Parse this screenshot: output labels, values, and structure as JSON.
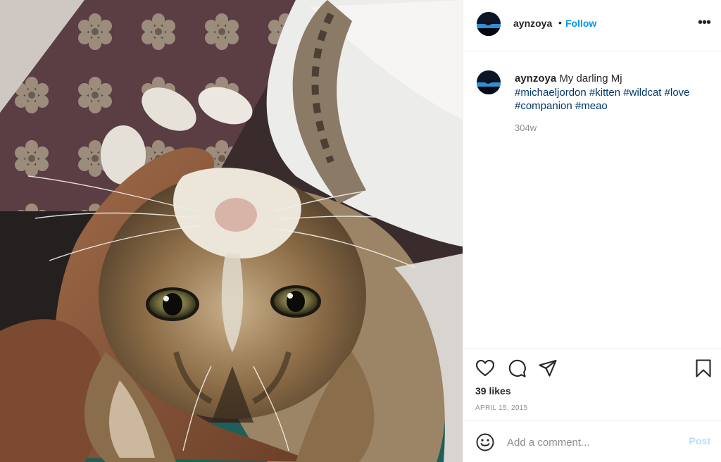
{
  "post": {
    "photo_alt": "Photo by aynzoya on April 15, 2015.",
    "header": {
      "username": "aynzoya",
      "separator": "•",
      "follow_label": "Follow",
      "more_icon": "more-options-icon"
    },
    "caption": {
      "username": "aynzoya",
      "text": "My darling Mj",
      "hashtags": [
        "#michaeljordon",
        "#kitten",
        "#wildcat",
        "#love",
        "#companion",
        "#meao"
      ],
      "age": "304w"
    },
    "actions": {
      "like_icon": "heart-icon",
      "comment_icon": "comment-icon",
      "share_icon": "share-icon",
      "save_icon": "bookmark-icon",
      "likes": "39 likes",
      "date": "APRIL 15, 2015"
    },
    "comment_box": {
      "emoji_icon": "emoji-icon",
      "placeholder": "Add a comment...",
      "post_label": "Post"
    },
    "colors": {
      "follow": "#0095f6",
      "hashtag": "#00376b",
      "muted": "#8e8e8e",
      "post_disabled": "#b2dffc",
      "border": "#efefef"
    }
  }
}
